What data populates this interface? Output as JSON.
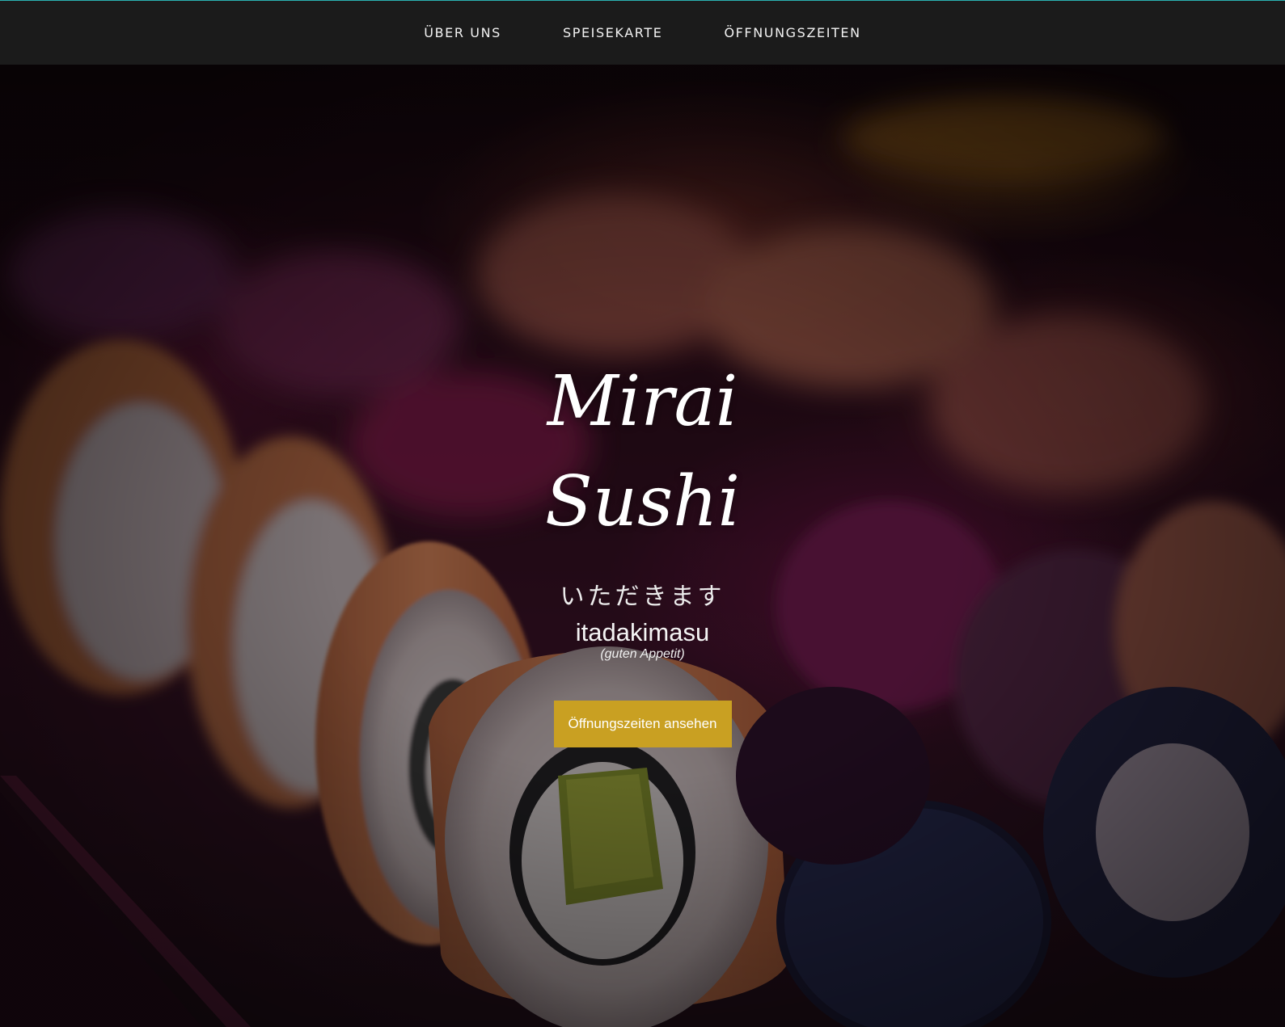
{
  "nav": {
    "items": [
      {
        "label": "ÜBER UNS"
      },
      {
        "label": "SPEISEKARTE"
      },
      {
        "label": "ÖFFNUNGSZEITEN"
      }
    ]
  },
  "hero": {
    "brand_line1": "Mirai",
    "brand_line2": "Sushi",
    "japanese": "いただきます",
    "romaji": "itadakimasu",
    "translation": "(guten Appetit)",
    "cta_label": "Öffnungszeiten ansehen"
  },
  "colors": {
    "nav_background": "#1b1b1b",
    "nav_top_border": "#2bb3b3",
    "cta_background": "#c9a022",
    "text": "#ffffff"
  }
}
